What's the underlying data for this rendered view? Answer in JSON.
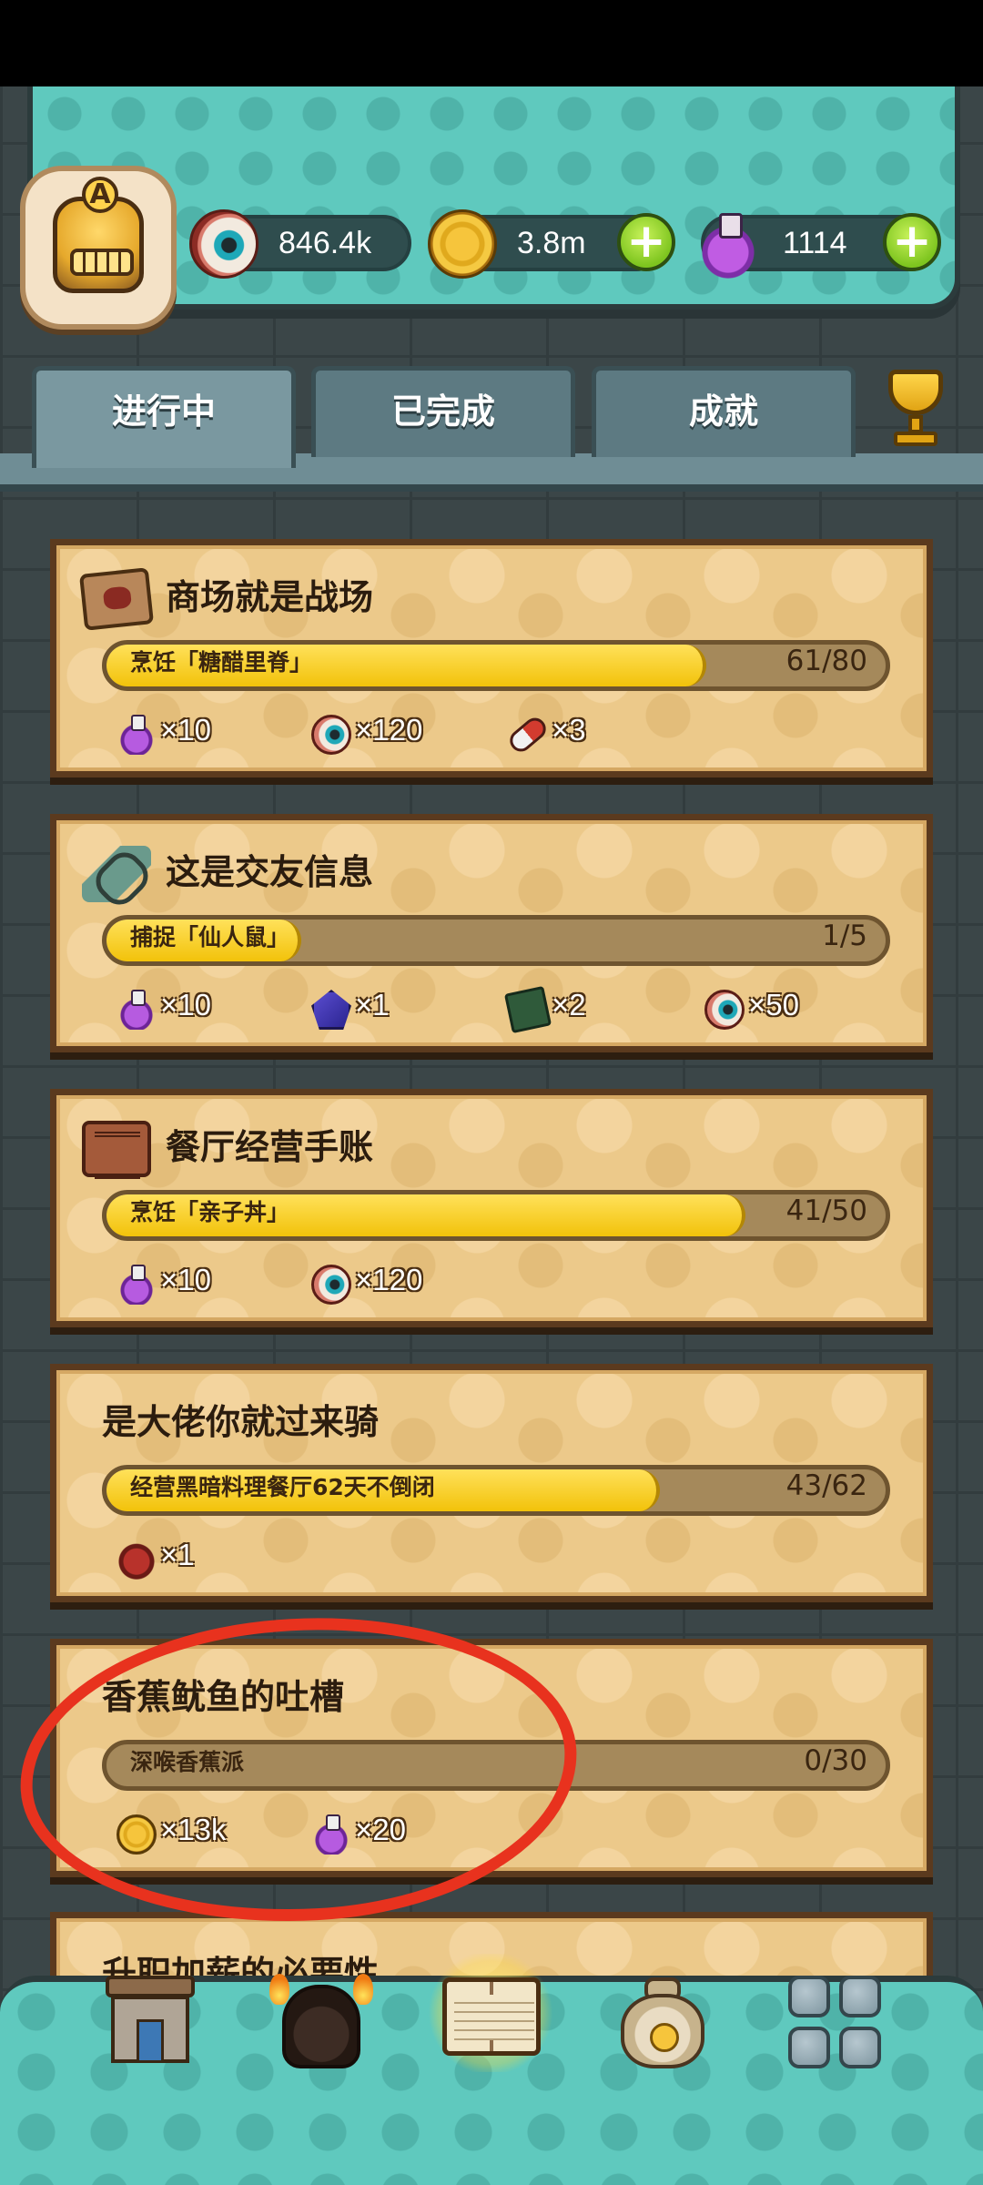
{
  "header": {
    "avatar_rank": "A",
    "eyeballs": "846.4k",
    "coins": "3.8m",
    "potions": "1114"
  },
  "tabs": [
    {
      "label": "进行中",
      "active": true
    },
    {
      "label": "已完成",
      "active": false
    },
    {
      "label": "成就",
      "active": false
    }
  ],
  "quests": [
    {
      "title": "商场就是战场",
      "icon": "map-icon",
      "task": "烹饪「糖醋里脊」",
      "count": "61/80",
      "progress": 0.7625,
      "rewards": [
        {
          "icon": "potion-icon",
          "text": "×10"
        },
        {
          "icon": "eyeball-icon",
          "text": "×120"
        },
        {
          "icon": "candy-icon",
          "text": "×3"
        }
      ]
    },
    {
      "title": "这是交友信息",
      "icon": "bottle-icon",
      "task": "捕捉「仙人鼠」",
      "count": "1/5",
      "progress": 0.2,
      "rewards": [
        {
          "icon": "potion-icon",
          "text": "×10"
        },
        {
          "icon": "crystal-icon",
          "text": "×1"
        },
        {
          "icon": "card-icon",
          "text": "×2"
        },
        {
          "icon": "eyeball-icon",
          "text": "×50"
        }
      ]
    },
    {
      "title": "餐厅经营手账",
      "icon": "book-icon",
      "task": "烹饪「亲子丼」",
      "count": "41/50",
      "progress": 0.82,
      "rewards": [
        {
          "icon": "potion-icon",
          "text": "×10"
        },
        {
          "icon": "eyeball-icon",
          "text": "×120"
        }
      ]
    },
    {
      "title": "是大佬你就过来骑",
      "task": "经营黑暗料理餐厅62天不倒闭",
      "count": "43/62",
      "progress": 0.6935,
      "rewards": [
        {
          "icon": "monster-icon",
          "text": "×1"
        }
      ]
    },
    {
      "title": "香蕉鱿鱼的吐槽",
      "task": "深喉香蕉派",
      "count": "0/30",
      "progress": 0,
      "rewards": [
        {
          "icon": "coin-icon",
          "text": "×13k"
        },
        {
          "icon": "potion-icon",
          "text": "×20"
        }
      ]
    },
    {
      "title": "升职加薪的必要性"
    }
  ],
  "colors": {
    "annotation": "#e8321e",
    "progress_fill": "#f2c20a",
    "card_bg": "#ecc98a"
  }
}
